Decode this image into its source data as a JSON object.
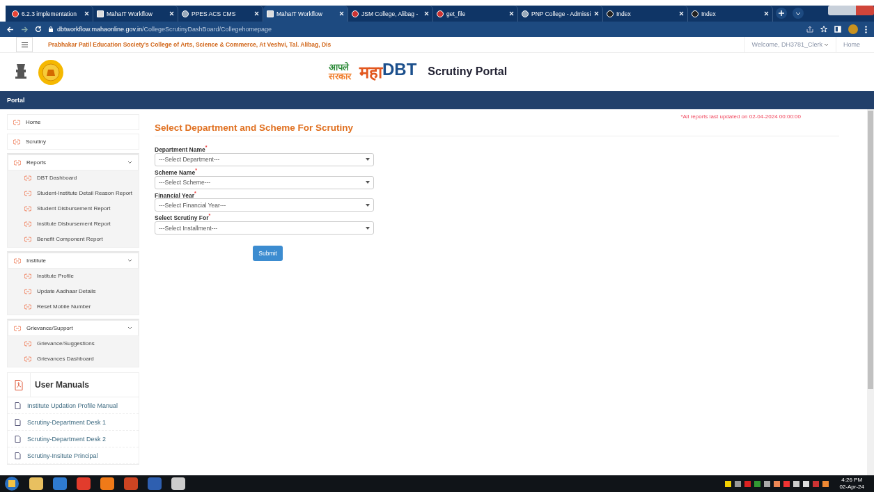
{
  "browser": {
    "tabs": [
      {
        "title": "6.2.3 implementation",
        "selected": false,
        "kind": "mail"
      },
      {
        "title": "MahaIT Workflow",
        "selected": false,
        "kind": "site"
      },
      {
        "title": "PPES ACS CMS",
        "selected": false,
        "kind": "person"
      },
      {
        "title": "MahaIT Workflow",
        "selected": true,
        "kind": "site"
      },
      {
        "title": "JSM College, Alibag -",
        "selected": false,
        "kind": "circle"
      },
      {
        "title": "get_file",
        "selected": false,
        "kind": "circle"
      },
      {
        "title": "PNP College - Admissi",
        "selected": false,
        "kind": "person"
      },
      {
        "title": "Index",
        "selected": false,
        "kind": "globe"
      },
      {
        "title": "Index",
        "selected": false,
        "kind": "globe"
      }
    ],
    "url_host": "dbtworkflow.mahaonline.gov.in",
    "url_path": "/CollegeScrutinyDashBoard/Collegehomepage"
  },
  "site_header": {
    "college": "Prabhakar Patil Education Society's College of Arts, Science & Commerce, At Veshvi, Tal. Alibag, Dis",
    "welcome": "Welcome, DH3781_Clerk",
    "home": "Home"
  },
  "logo_bar": {
    "logo_line_1": "आपले",
    "logo_line_2": "सरकार",
    "brand_left": "महा",
    "brand_right": "DBT",
    "portal_title": "Scrutiny Portal"
  },
  "nav_bar": {
    "title": "Portal"
  },
  "sidebar": [
    {
      "kind": "link",
      "label": "Home"
    },
    {
      "kind": "link",
      "label": "Scrutiny"
    },
    {
      "kind": "group",
      "label": "Reports",
      "expanded": true,
      "children": [
        {
          "label": "DBT Dashboard"
        },
        {
          "label": "Student-Institute Detail Reason Report"
        },
        {
          "label": "Student Disbursement Report"
        },
        {
          "label": "Institute Disbursement Report"
        },
        {
          "label": "Benefit Component Report"
        }
      ]
    },
    {
      "kind": "group",
      "label": "Institute",
      "expanded": true,
      "children": [
        {
          "label": "Institute Profile"
        },
        {
          "label": "Update Aadhaar Details"
        },
        {
          "label": "Reset Mobile Number"
        }
      ]
    },
    {
      "kind": "group",
      "label": "Grievance/Support",
      "expanded": true,
      "children": [
        {
          "label": "Grievance/Suggestions"
        },
        {
          "label": "Grievances Dashboard"
        }
      ]
    }
  ],
  "user_manuals": {
    "title": "User Manuals",
    "items": [
      "Institute Updation Profile Manual",
      "Scrutiny-Department Desk 1",
      "Scrutiny-Department Desk 2",
      "Scrutiny-Insitute Principal"
    ]
  },
  "form": {
    "notice": "*All reports last updated on 02-04-2024 00:00:00",
    "title": "Select Department and Scheme For Scrutiny",
    "fields": [
      {
        "label": "Department Name",
        "required_mark": "*",
        "value": "---Select Department---"
      },
      {
        "label": "Scheme Name",
        "required_mark": "*",
        "value": "---Select Scheme---"
      },
      {
        "label": "Financial Year",
        "required_mark": "*",
        "value": "---Select Financial Year---"
      },
      {
        "label": "Select Scrutiny For",
        "required_mark": "*",
        "value": "---Select Installment---"
      }
    ],
    "submit": "Submit"
  },
  "taskbar": {
    "time": "4:26 PM",
    "date": "02-Apr-24"
  }
}
